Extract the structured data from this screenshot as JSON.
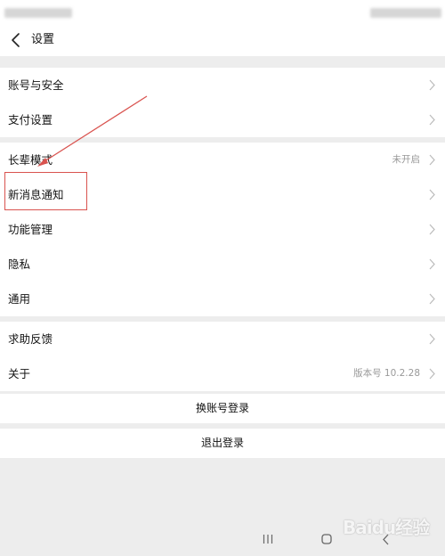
{
  "header": {
    "title": "设置"
  },
  "sections": [
    {
      "items": [
        {
          "label": "账号与安全",
          "value": ""
        },
        {
          "label": "支付设置",
          "value": ""
        }
      ]
    },
    {
      "items": [
        {
          "label": "长辈模式",
          "value": "未开启"
        },
        {
          "label": "新消息通知",
          "value": ""
        },
        {
          "label": "功能管理",
          "value": ""
        },
        {
          "label": "隐私",
          "value": ""
        },
        {
          "label": "通用",
          "value": ""
        }
      ]
    },
    {
      "items": [
        {
          "label": "求助反馈",
          "value": ""
        },
        {
          "label": "关于",
          "value": "版本号 10.2.28"
        }
      ]
    }
  ],
  "actions": {
    "switch_account": "换账号登录",
    "logout": "退出登录"
  },
  "watermark": {
    "text": "Baidu经验"
  },
  "colors": {
    "background": "#ededed",
    "row_background": "#ffffff",
    "secondary_text": "#999999",
    "annotation_red": "#d9534f"
  }
}
